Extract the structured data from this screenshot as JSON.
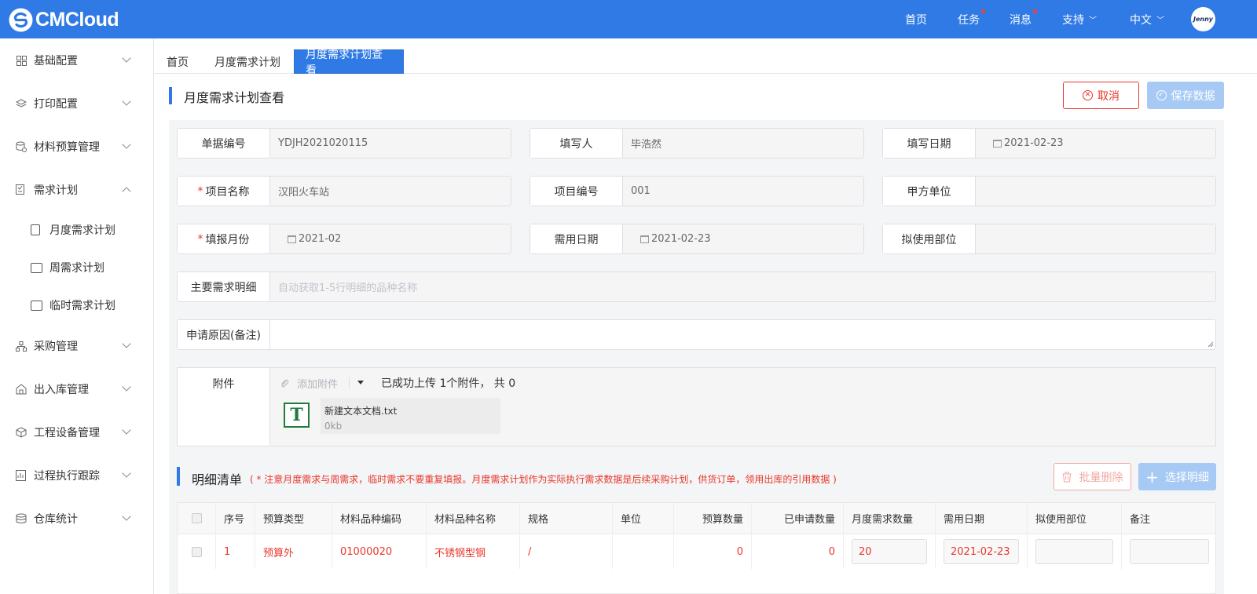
{
  "app": {
    "logo_text": "CMCloud"
  },
  "header": {
    "nav": [
      {
        "label": "首页",
        "dot": false
      },
      {
        "label": "任务",
        "dot": true
      },
      {
        "label": "消息",
        "dot": true
      },
      {
        "label": "支持",
        "dot": false,
        "dropdown": true
      },
      {
        "label": "中文",
        "dot": false,
        "dropdown": true
      }
    ],
    "avatar_text": "Jenny"
  },
  "sidebar": {
    "items": [
      {
        "label": "基础配置",
        "icon": "grid-icon"
      },
      {
        "label": "打印配置",
        "icon": "layers-icon"
      },
      {
        "label": "材料预算管理",
        "icon": "database-icon"
      },
      {
        "label": "需求计划",
        "icon": "checklist-icon",
        "expanded": true
      },
      {
        "label": "采购管理",
        "icon": "org-chart-icon"
      },
      {
        "label": "出入库管理",
        "icon": "warehouse-icon"
      },
      {
        "label": "工程设备管理",
        "icon": "cube-icon"
      },
      {
        "label": "过程执行跟踪",
        "icon": "tracking-icon"
      },
      {
        "label": "仓库统计",
        "icon": "stack-icon"
      }
    ],
    "subitems": [
      {
        "label": "月度需求计划",
        "icon": "document-icon"
      },
      {
        "label": "周需求计划",
        "icon": "calendar-icon"
      },
      {
        "label": "临时需求计划",
        "icon": "card-icon"
      }
    ]
  },
  "tabs": [
    {
      "label": "首页"
    },
    {
      "label": "月度需求计划"
    },
    {
      "label": "月度需求计划查看",
      "active": true
    }
  ],
  "page": {
    "title": "月度需求计划查看",
    "cancel_label": "取消",
    "save_label": "保存数据"
  },
  "form": {
    "doc_no_label": "单据编号",
    "doc_no": "YDJH2021020115",
    "filler_label": "填写人",
    "filler": "毕浩然",
    "fill_date_label": "填写日期",
    "fill_date": "2021-02-23",
    "project_name_label": "项目名称",
    "project_name": "汉阳火车站",
    "project_no_label": "项目编号",
    "project_no": "001",
    "party_a_label": "甲方单位",
    "party_a": "",
    "report_month_label": "填报月份",
    "report_month": "2021-02",
    "need_date_label": "需用日期",
    "need_date": "2021-02-23",
    "use_part_label": "拟使用部位",
    "use_part": "",
    "main_detail_label": "主要需求明细",
    "main_detail_placeholder": "自动获取1-5行明细的品种名称",
    "reason_label": "申请原因(备注)",
    "reason": ""
  },
  "attachment": {
    "label": "附件",
    "add_label": "添加附件",
    "status": "已成功上传 1个附件， 共 0",
    "file_name": "新建文本文档.txt",
    "file_size": "0kb",
    "file_icon_letter": "T"
  },
  "detail": {
    "title": "明细清单",
    "note": "( * 注意月度需求与周需求，临时需求不要重复填报。月度需求计划作为实际执行需求数据是后续采购计划，供货订单，领用出库的引用数据 )",
    "batch_delete_label": "批量删除",
    "select_label": "选择明细",
    "columns": [
      "序号",
      "预算类型",
      "材料品种编码",
      "材料品种名称",
      "规格",
      "单位",
      "预算数量",
      "已申请数量",
      "月度需求数量",
      "需用日期",
      "拟使用部位",
      "备注"
    ],
    "rows": [
      {
        "no": "1",
        "budget_type": "预算外",
        "code": "01000020",
        "name": "不锈钢型钢",
        "spec": "/",
        "unit": "",
        "budget_qty": "0",
        "applied_qty": "0",
        "month_qty": "20",
        "need_date": "2021-02-23",
        "use_part": "",
        "remark": ""
      }
    ]
  }
}
